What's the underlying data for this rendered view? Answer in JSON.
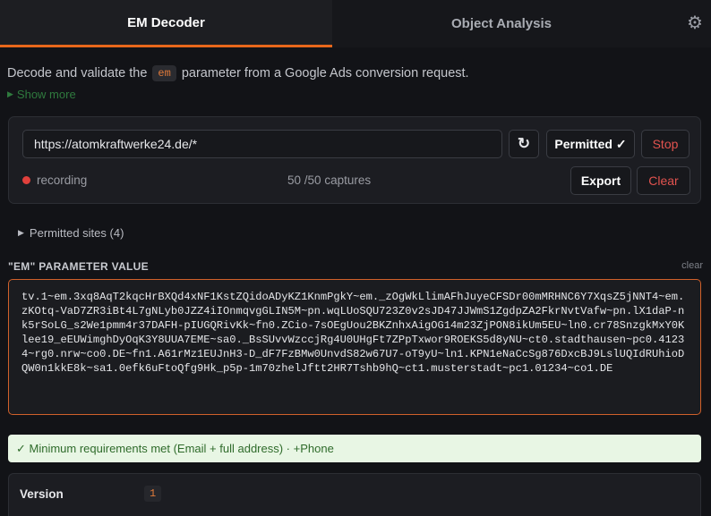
{
  "tabs": [
    {
      "label": "EM Decoder",
      "active": true
    },
    {
      "label": "Object Analysis",
      "active": false
    }
  ],
  "settings_icon": "gear-icon",
  "intro": {
    "before": "Decode and validate the",
    "param": "em",
    "after": "parameter from a Google Ads conversion request."
  },
  "show_more": "Show more",
  "recorder": {
    "url_value": "https://atomkraftwerke24.de/*",
    "reload_icon": "reload-icon",
    "permitted_label": "Permitted ✓",
    "stop_label": "Stop",
    "status": "recording",
    "captures_count": "50",
    "captures_total": "/50 captures",
    "export_label": "Export",
    "clear_label": "Clear"
  },
  "permitted_sites": "Permitted sites (4)",
  "param_section": {
    "label": "\"EM\" PARAMETER VALUE",
    "clear": "clear",
    "value": "tv.1~em.3xq8AqT2kqcHrBXQd4xNF1KstZQidoADyKZ1KnmPgkY~em._zOgWkLlimAFhJuyeCFSDr00mMRHNC6Y7XqsZ5jNNT4~em.zKOtq-VaD7ZR3iBt4L7gNLyb0JZZ4iIOnmqvgGLIN5M~pn.wqLUoSQU723Z0v2sJD47JJWmS1ZgdpZA2FkrNvtVafw~pn.lX1daP-nk5rSoLG_s2We1pmm4r37DAFH-pIUGQRivKk~fn0.ZCio-7sOEgUou2BKZnhxAigOG14m23ZjPON8ikUm5EU~ln0.cr78SnzgkMxY0Klee19_eEUWimghDyOqK3Y8UUA7EME~sa0._BsSUvvWzccjRg4U0UHgFt7ZPpTxwor9ROEKS5d8yNU~ct0.stadthausen~pc0.41234~rg0.nrw~co0.DE~fn1.A61rMz1EUJnH3-D_dF7FzBMw0UnvdS82w67U7-oT9yU~ln1.KPN1eNaCcSg876DxcBJ9LslUQIdRUhioDQW0n1kkE8k~sa1.0efk6uFtoQfg9Hk_p5p-1m70zhelJftt2HR7Tshb9hQ~ct1.musterstadt~pc1.01234~co1.DE"
  },
  "requirements": "✓ Minimum requirements met (Email + full address) · +Phone",
  "version": {
    "label": "Version",
    "value": "1"
  },
  "colors": {
    "accent": "#e8671b",
    "stop_red": "#e2534f",
    "success_bg": "#e8f6e4",
    "background": "#121317"
  }
}
